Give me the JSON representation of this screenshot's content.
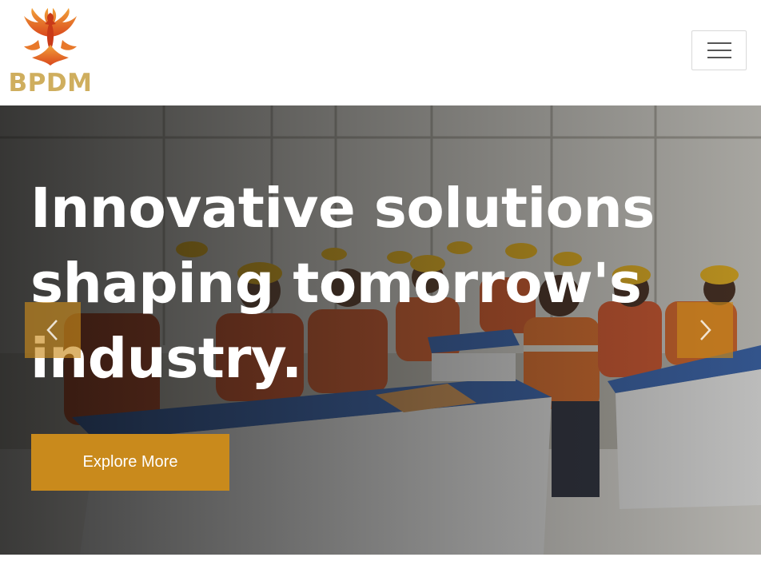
{
  "header": {
    "logo_text": "BPDM",
    "menu_icon": "hamburger-icon"
  },
  "hero": {
    "headline_lines": [
      "Innovative solutions",
      "shaping tomorrow's",
      "industry."
    ],
    "cta_label": "Explore More",
    "prev_icon": "chevron-left-icon",
    "next_icon": "chevron-right-icon"
  },
  "colors": {
    "brand_gold": "#cfae5e",
    "accent_orange": "#c98a1c",
    "logo_flame": "#e0651f"
  }
}
